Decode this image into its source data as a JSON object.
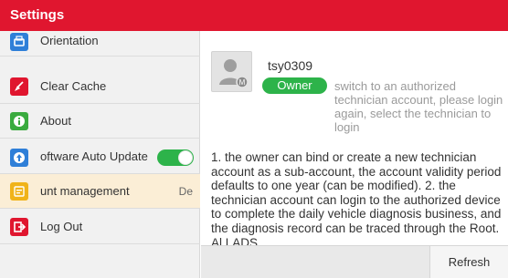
{
  "header": {
    "title": "Settings"
  },
  "sidebar": {
    "items": [
      {
        "label": "Orientation",
        "icon": "orientation-icon",
        "icon_color": "#2f7fd8"
      },
      {
        "label": "Clear Cache",
        "icon": "broom-icon",
        "icon_color": "#e0162f"
      },
      {
        "label": "About",
        "icon": "info-icon",
        "icon_color": "#3aab3f"
      },
      {
        "label": "oftware Auto Update",
        "icon": "update-icon",
        "icon_color": "#2f7fd8",
        "toggle_on": true
      },
      {
        "label": "unt management",
        "trailing": "De",
        "icon": "account-icon",
        "icon_color": "#f0b31a",
        "active": true
      },
      {
        "label": "Log Out",
        "icon": "logout-icon",
        "icon_color": "#e0162f"
      }
    ]
  },
  "account": {
    "username": "tsy0309",
    "role": "Owner",
    "role_hint": "switch to an authorized technician account, please login again, select the technician to login",
    "description": "1. the owner can bind or create a new technician account as a sub-account, the account validity period defaults to one year (can be modified). 2. the technician account can login to the authorized device to complete the daily vehicle diagnosis business, and the diagnosis record can be traced through the Root. Al LADS"
  },
  "footer": {
    "refresh_label": "Refresh"
  },
  "colors": {
    "brand": "#e0162f",
    "accent_green": "#2db34a",
    "active_row": "#fbeed6"
  }
}
